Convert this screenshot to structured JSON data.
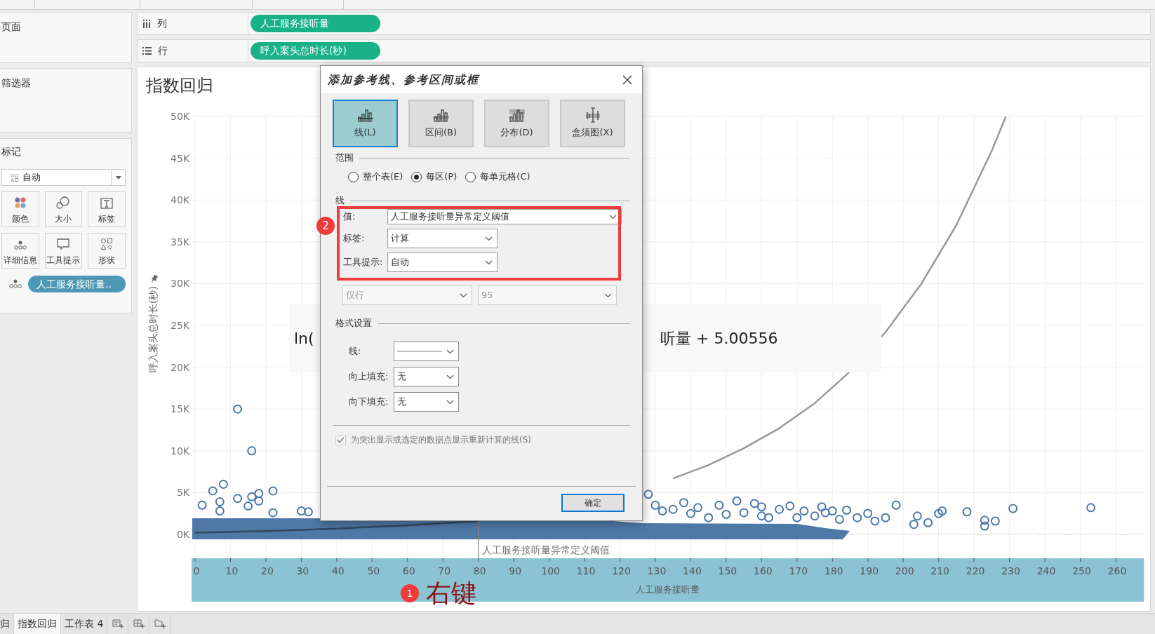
{
  "left_panel": {
    "pages": {
      "title": "页面"
    },
    "filters": {
      "title": "筛选器"
    },
    "marks": {
      "title": "标记",
      "mark_type": "自动",
      "cards": [
        {
          "label": "颜色",
          "kind": "color"
        },
        {
          "label": "大小",
          "kind": "size"
        },
        {
          "label": "标签",
          "kind": "label"
        },
        {
          "label": "详细信息",
          "kind": "detail"
        },
        {
          "label": "工具提示",
          "kind": "tooltip"
        },
        {
          "label": "形状",
          "kind": "shape"
        }
      ],
      "fields": [
        {
          "label": "人工服务接听量.."
        }
      ]
    }
  },
  "shelves": [
    {
      "kind": "columns",
      "label": "列",
      "pill": "人工服务接听量"
    },
    {
      "kind": "rows",
      "label": "行",
      "pill": "呼入案头总时长(秒)"
    }
  ],
  "sheet": {
    "equation_left": "ln(",
    "equation_right": "听量 + 5.00556",
    "chart_data": {
      "type": "scatter",
      "title": "指数回归",
      "xlabel": "人工服务接听量",
      "ylabel": "呼入案头总时长(秒)",
      "grid": true,
      "x": [
        12,
        16,
        8,
        5,
        22,
        18,
        12,
        16,
        7,
        18,
        2,
        15,
        7,
        22,
        30,
        32,
        128,
        130,
        132,
        135,
        138,
        140,
        142,
        145,
        148,
        153,
        155,
        158,
        160,
        162,
        165,
        168,
        172,
        175,
        177,
        178,
        180,
        182,
        184,
        187,
        190,
        192,
        195,
        198,
        203,
        204,
        207,
        210,
        211,
        218,
        223,
        223,
        226,
        231,
        253,
        150,
        160,
        170
      ],
      "series": [
        {
          "type": "line",
          "color": "#33475b",
          "x": [
            0,
            20,
            40,
            60,
            80
          ],
          "values": [
            200,
            400,
            700,
            1100,
            1600
          ]
        },
        {
          "type": "line",
          "color": "#999999",
          "x": [
            135,
            145,
            155,
            165,
            175,
            185,
            195,
            205,
            215,
            225,
            229
          ],
          "values": [
            6700,
            8300,
            10300,
            12700,
            15700,
            19500,
            24200,
            29900,
            37000,
            45900,
            50000
          ]
        },
        {
          "type": "scatter",
          "color": "#4e79a7",
          "values": [
            15000,
            10000,
            6000,
            5200,
            5200,
            4900,
            4300,
            4500,
            3900,
            4000,
            3500,
            3400,
            2800,
            2600,
            2800,
            2700,
            4800,
            3500,
            2800,
            3000,
            3800,
            2500,
            3200,
            2000,
            3500,
            4000,
            2600,
            3700,
            3300,
            2000,
            3000,
            3400,
            2800,
            2200,
            3300,
            2600,
            2800,
            1800,
            2900,
            2000,
            2500,
            1600,
            2000,
            3500,
            1200,
            2200,
            1400,
            2500,
            2800,
            2700,
            1000,
            1700,
            1600,
            3100,
            3200,
            2400,
            2200,
            2000
          ]
        }
      ],
      "xticks": [
        0,
        10,
        20,
        30,
        40,
        50,
        60,
        70,
        80,
        90,
        100,
        110,
        120,
        130,
        140,
        150,
        160,
        170,
        180,
        190,
        200,
        210,
        220,
        230,
        240,
        250,
        260
      ],
      "yticks": [
        {
          "value": 0,
          "label": "0K"
        },
        {
          "value": 5000,
          "label": "5K"
        },
        {
          "value": 10000,
          "label": "10K"
        },
        {
          "value": 15000,
          "label": "15K"
        },
        {
          "value": 20000,
          "label": "20K"
        },
        {
          "value": 25000,
          "label": "25K"
        },
        {
          "value": 30000,
          "label": "30K"
        },
        {
          "value": 35000,
          "label": "35K"
        },
        {
          "value": 40000,
          "label": "40K"
        },
        {
          "value": 45000,
          "label": "45K"
        },
        {
          "value": 50000,
          "label": "50K"
        }
      ],
      "xlim": [
        -1,
        268
      ],
      "ylim": [
        -2850,
        50000
      ],
      "ref_lines": [
        {
          "axis": "x",
          "value": 80,
          "label": "人工服务接听量异常定义阈值"
        },
        {
          "axis": "y",
          "value": 0
        }
      ]
    }
  },
  "dialog": {
    "title": "添加参考线、参考区间或框",
    "types": [
      {
        "label": "线(L)",
        "kind": "line",
        "selected": true
      },
      {
        "label": "区间(B)",
        "kind": "band",
        "selected": false
      },
      {
        "label": "分布(D)",
        "kind": "distribution",
        "selected": false
      },
      {
        "label": "盒须图(X)",
        "kind": "boxplot",
        "selected": false
      }
    ],
    "scope": {
      "heading": "范围",
      "options": [
        {
          "label": "整个表(E)",
          "selected": false
        },
        {
          "label": "每区(P)",
          "selected": true
        },
        {
          "label": "每单元格(C)",
          "selected": false
        }
      ]
    },
    "line": {
      "heading": "线",
      "fields": [
        {
          "label": "值:",
          "value": "人工服务接听量异常定义阈值",
          "kind": "wide"
        },
        {
          "label": "标签:",
          "value": "计算",
          "kind": "narrow"
        },
        {
          "label": "工具提示:",
          "value": "自动",
          "kind": "narrow"
        }
      ]
    },
    "confidence": [
      {
        "value": "仅行",
        "disabled": true
      },
      {
        "value": "95",
        "disabled": true
      }
    ],
    "format": {
      "heading": "格式设置",
      "fields": [
        {
          "label": "线:",
          "kind": "line"
        },
        {
          "label": "向上填充:",
          "kind": "text",
          "value": "无"
        },
        {
          "label": "向下填充:",
          "kind": "text",
          "value": "无"
        }
      ]
    },
    "recalc": {
      "label": "为突出显示或选定的数据点显示重新计算的线(S)",
      "checked": true,
      "disabled": true
    },
    "ok": "确定"
  },
  "annotations": [
    {
      "number": "2",
      "kind": "badge"
    },
    {
      "number": "1",
      "kind": "badge_with_text",
      "text": "右键"
    }
  ],
  "tabs": [
    {
      "label": "归",
      "selected": false
    },
    {
      "label": "指数回归",
      "selected": true
    },
    {
      "label": "工作表 4",
      "selected": false
    }
  ]
}
